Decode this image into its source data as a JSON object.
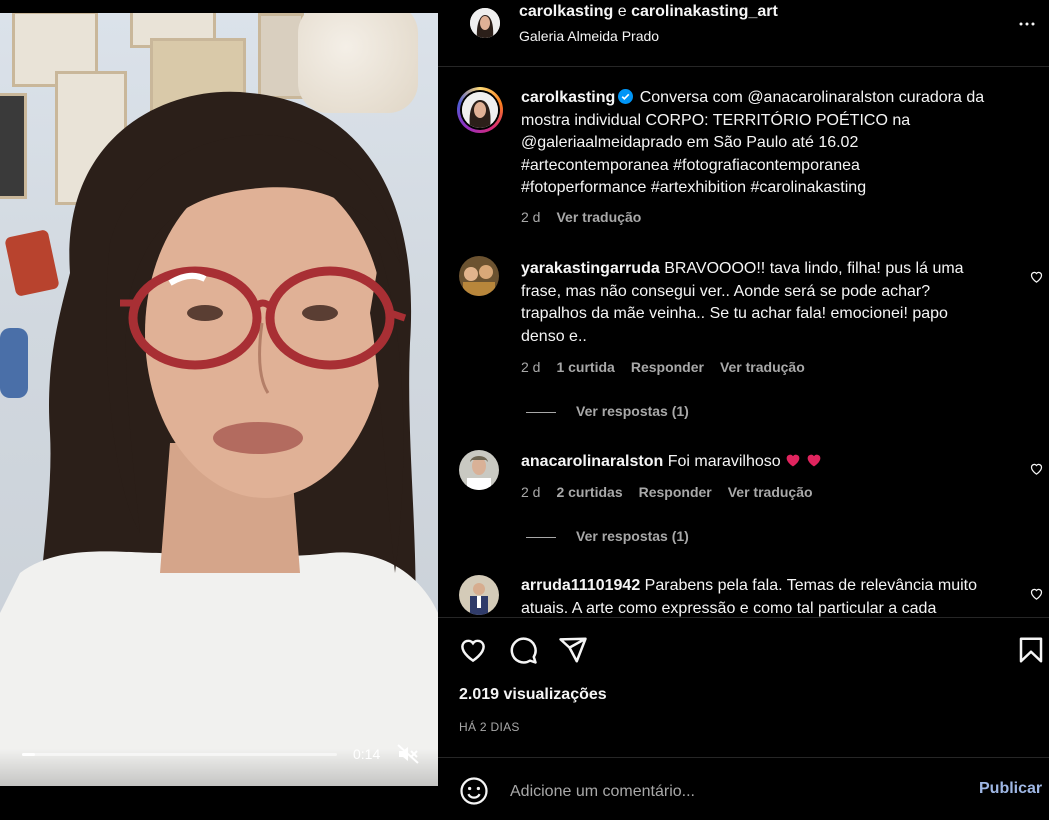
{
  "video": {
    "time": "0:14",
    "progress": 0.04
  },
  "header": {
    "user1": "carolkasting",
    "conjunction": "e",
    "user2": "carolinakasting_art",
    "location": "Galeria Almeida Prado"
  },
  "caption": {
    "username": "carolkasting",
    "line1": "Conversa com @anacarolinaralston curadora da",
    "line2": "mostra individual CORPO: TERRITÓRIO POÉTICO na",
    "line3": "@galeriaalmeidaprado em São Paulo até 16.02",
    "line4": "#artecontemporanea #fotografiacontemporanea",
    "line5": "#fotoperformance #artexhibition #carolinakasting",
    "time": "2 d",
    "translate": "Ver tradução"
  },
  "comments": [
    {
      "username": "yarakastingarruda",
      "text_first": "BRAVOOOO!! tava lindo, filha! pus lá uma",
      "line2": "frase, mas não consegui ver.. Aonde será se pode achar?",
      "line3": "trapalhos da mãe veinha.. Se tu achar fala! emocionei! papo",
      "line4": "denso e..",
      "time": "2 d",
      "likes": "1 curtida",
      "reply": "Responder",
      "translate": "Ver tradução",
      "view_replies": "Ver respostas (1)"
    },
    {
      "username": "anacarolinaralston",
      "text_first": "Foi maravilhoso",
      "time": "2 d",
      "likes": "2 curtidas",
      "reply": "Responder",
      "translate": "Ver tradução",
      "view_replies": "Ver respostas (1)"
    },
    {
      "username": "arruda11101942",
      "text_first": "Parabens pela fala. Temas de relevância muito",
      "line2": "atuais. A arte como expressão e como tal particular a cada"
    }
  ],
  "stats": {
    "views": "2.019 visualizações",
    "ago": "HÁ 2 DIAS"
  },
  "add_comment": {
    "placeholder": "Adicione um comentário...",
    "publish": "Publicar"
  },
  "icons": {
    "like": "heart-icon",
    "comment": "comment-icon",
    "share": "share-icon",
    "save": "bookmark-icon",
    "more": "more-icon",
    "mute": "muted-speaker-icon",
    "emoji": "emoji-icon"
  },
  "colors": {
    "background": "#000000",
    "text": "#f5f5f5",
    "secondary": "#a8a8a8",
    "publish": "#9fb7e4",
    "heart_emoji": "#e0245e"
  }
}
